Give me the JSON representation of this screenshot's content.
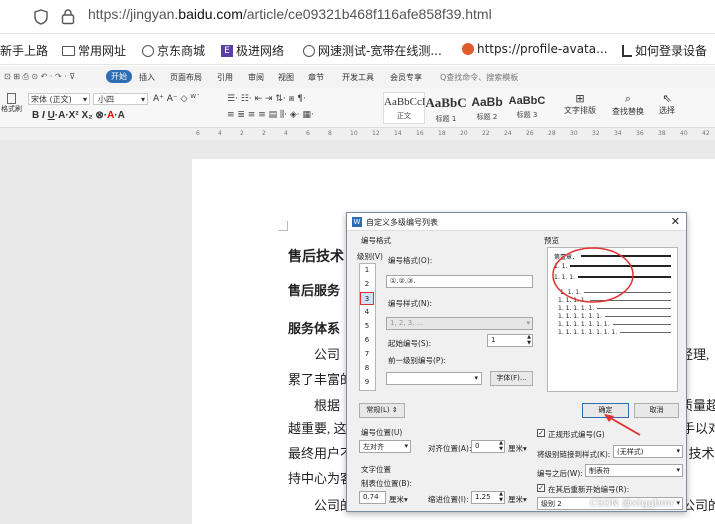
{
  "browser": {
    "url_prefix": "https://jingyan.",
    "url_domain": "baidu.com",
    "url_path": "/article/ce09321b468f116afe858f39.html",
    "bookmarks": [
      "新手上路",
      "常用网址",
      "京东商城",
      "极进网络",
      "网速测试-宽带在线测...",
      "https://profile-avata...",
      "如何登录设备"
    ]
  },
  "wps": {
    "start_tab": "开始",
    "tabs": [
      "插入",
      "页面布局",
      "引用",
      "审阅",
      "视图",
      "章节",
      "开发工具",
      "会员专享"
    ],
    "search_placeholder": "Q查找命令、搜索模板",
    "font_name": "宋体 (正文)",
    "font_size": "小四",
    "format_painter": "格式刷",
    "styles": [
      {
        "sample": "AaBbCcI",
        "label": "正文"
      },
      {
        "sample": "AaBbC",
        "label": "标题 1"
      },
      {
        "sample": "AaBb",
        "label": "标题 2"
      },
      {
        "sample": "AaBbC",
        "label": "标题 3"
      }
    ],
    "text_layout": "文字排版",
    "find_replace": "查找替换",
    "select": "选择",
    "ruler_ticks": [
      "6",
      "4",
      "2",
      "2",
      "4",
      "6",
      "8",
      "10",
      "12",
      "14",
      "16",
      "18",
      "20",
      "22",
      "24",
      "26",
      "28",
      "30",
      "32",
      "34",
      "36",
      "38",
      "40",
      "42"
    ]
  },
  "document": {
    "heading1": "售后技术",
    "heading2": "售后服务",
    "heading3": "服务体系",
    "para1_start": "公司",
    "para1_end": "经理,",
    "line_accum": "累了丰富的",
    "para2_start": "根据",
    "para2_end": "质量超",
    "line_important": "越重要, 这",
    "line_important_end": "手以对",
    "line_user": "最终用户不",
    "line_user_end": ", 技术",
    "line_center": "持中心为客",
    "para3_start": "公司的",
    "para3_end": "公司的"
  },
  "dialog": {
    "title": "自定义多级编号列表",
    "group_number_format": "编号格式",
    "level_label": "级别(V)",
    "levels": [
      "1",
      "2",
      "3",
      "4",
      "5",
      "6",
      "7",
      "8",
      "9"
    ],
    "selected_level": "3",
    "format_label": "编号格式(O):",
    "format_value": "①.②.③.",
    "style_label": "编号样式(N):",
    "style_value": "1, 2, 3, ...",
    "start_label": "起始编号(S):",
    "start_value": "1",
    "prev_level_label": "前一级别编号(P):",
    "font_button": "字体(F)...",
    "preview_label": "预览",
    "preview_lines": [
      "第壹章．",
      "1. 1.",
      "1. 1. 1.",
      "1. 1. 1.",
      "1. 1. 1. 1.",
      "1. 1. 1. 1. 1.",
      "1. 1. 1. 1. 1. 1.",
      "1. 1. 1. 1. 1. 1. 1.",
      "1. 1. 1. 1. 1. 1. 1. 1."
    ],
    "normal_button": "常规(L)",
    "ok_button": "确定",
    "cancel_button": "取消",
    "number_position_group": "编号位置(U)",
    "align_value": "左对齐",
    "align_pos_label": "对齐位置(A):",
    "align_pos_value": "0",
    "unit_cm": "厘米",
    "text_position_group": "文字位置",
    "tab_pos_label": "制表位位置(B):",
    "tab_pos_value": "0.74",
    "indent_label": "缩进位置(I):",
    "indent_value": "1.25",
    "normal_style_label": "正规形式编号(G)",
    "link_style_label": "将级别链接到样式(K):",
    "link_style_value": "(无样式)",
    "after_number_label": "编号之后(W):",
    "after_number_value": "制表符",
    "restart_label": "在其后重新开始编号(R):",
    "restart_value": "级别 2",
    "accent_red": "#e03131",
    "accent_blue": "#2e6db3"
  },
  "watermark": "CSDN @xtggbmr"
}
